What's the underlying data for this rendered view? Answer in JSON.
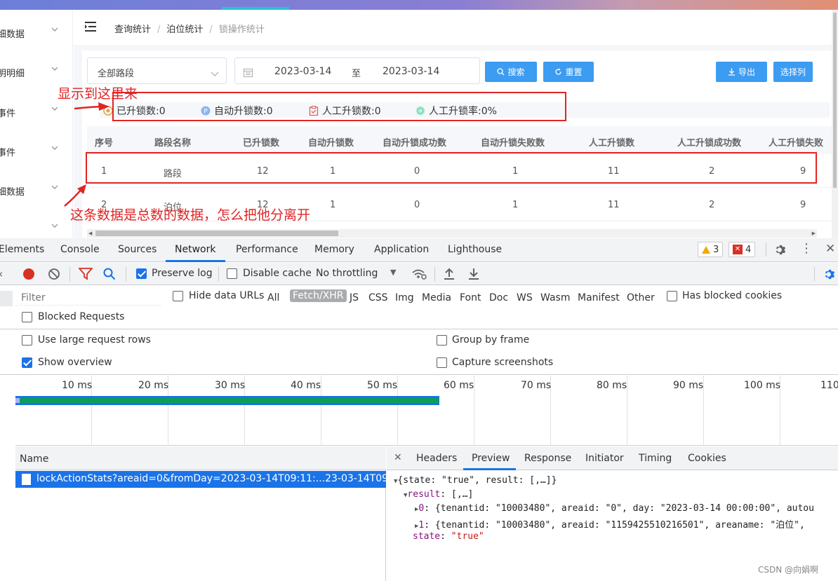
{
  "app": {
    "sidebar_items": [
      "细数据",
      "明明细",
      "事件",
      "事件",
      "细数据",
      ""
    ],
    "breadcrumbs": [
      "查询统计",
      "泊位统计",
      "锁操作统计"
    ],
    "filters": {
      "section_select": "全部路段",
      "date_from": "2023-03-14",
      "date_separator": "至",
      "date_to": "2023-03-14"
    },
    "buttons": {
      "search": "搜索",
      "reset": "重置",
      "export": "导出",
      "columns": "选择列"
    },
    "stats": [
      {
        "label": "已升锁数:0",
        "icon": "coin-icon",
        "color": "#e6a23c"
      },
      {
        "label": "自动升锁数:0",
        "icon": "p-circle-icon",
        "color": "#8cb4f5"
      },
      {
        "label": "人工升锁数:0",
        "icon": "clipboard-check-icon",
        "color": "#e05a5a"
      },
      {
        "label": "人工升锁率:0%",
        "icon": "rate-circle-icon",
        "color": "#5ccfa0"
      }
    ],
    "table": {
      "headers": [
        "序号",
        "路段名称",
        "已升锁数",
        "自动升锁数",
        "自动升锁成功数",
        "自动升锁失败数",
        "人工升锁数",
        "人工升锁成功数",
        "人工升锁失败"
      ],
      "rows": [
        [
          "1",
          "路段",
          "12",
          "1",
          "0",
          "1",
          "11",
          "2",
          "9"
        ],
        [
          "2",
          "泊位",
          "12",
          "1",
          "0",
          "1",
          "11",
          "2",
          "9"
        ]
      ]
    },
    "annotations": {
      "top_note": "显示到这里来",
      "bottom_note": "这条数据是总数的数据，怎么把他分离开"
    }
  },
  "devtools": {
    "tabs": [
      "Elements",
      "Console",
      "Sources",
      "Network",
      "Performance",
      "Memory",
      "Application",
      "Lighthouse"
    ],
    "active_tab": "Network",
    "warnings": "3",
    "errors": "4",
    "toolbar": {
      "preserve_log": "Preserve log",
      "disable_cache": "Disable cache",
      "throttling": "No throttling"
    },
    "filter_placeholder": "Filter",
    "hide_data_urls": "Hide data URLs",
    "filter_types": [
      "All",
      "Fetch/XHR",
      "JS",
      "CSS",
      "Img",
      "Media",
      "Font",
      "Doc",
      "WS",
      "Wasm",
      "Manifest",
      "Other"
    ],
    "has_blocked_cookies": "Has blocked cookies",
    "blocked_requests": "Blocked Requests",
    "settings": {
      "large_rows": "Use large request rows",
      "show_overview": "Show overview",
      "group_by_frame": "Group by frame",
      "capture_screenshots": "Capture screenshots"
    },
    "timeline_ticks": [
      "10 ms",
      "20 ms",
      "30 ms",
      "40 ms",
      "50 ms",
      "60 ms",
      "70 ms",
      "80 ms",
      "90 ms",
      "100 ms",
      "110"
    ],
    "name_header": "Name",
    "request_name": "lockActionStats?areaid=0&fromDay=2023-03-14T09:11:...23-03-14T09:1...",
    "preview_tabs": [
      "Headers",
      "Preview",
      "Response",
      "Initiator",
      "Timing",
      "Cookies"
    ],
    "preview": {
      "root": "{state: \"true\", result: [,…]}",
      "result_key": "result",
      "result_val": "[,…]",
      "item0_key": "0",
      "item0_val": "{tenantid: \"10003480\", areaid: \"0\", day: \"2023-03-14 00:00:00\", autou",
      "item1_key": "1",
      "item1_val": "{tenantid: \"10003480\", areaid: \"1159425510216501\", areaname: \"泊位\",",
      "state_key": "state",
      "state_val": "\"true\""
    }
  },
  "watermark": "CSDN @向娟啊"
}
